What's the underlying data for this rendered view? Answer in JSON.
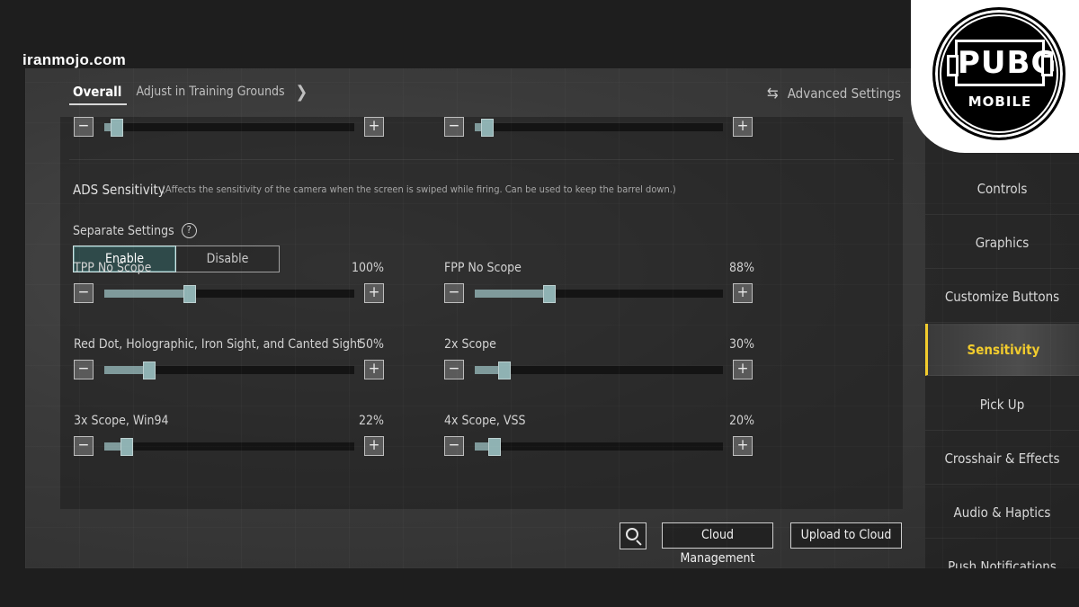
{
  "watermark": "iranmojo.com",
  "logo": {
    "title": "PUBG",
    "subtitle": "MOBILE"
  },
  "topnav": {
    "tab_overall": "Overall",
    "tab_adjust": "Adjust in Training Grounds",
    "advanced": "Advanced Settings"
  },
  "top_sliders": {
    "left_value": 0.05,
    "right_value": 0.05
  },
  "ads": {
    "title": "ADS Sensitivity",
    "description": "(Affects the sensitivity of the camera when the screen is swiped while firing. Can be used to keep the barrel down.)",
    "separate_label": "Separate Settings",
    "enable": "Enable",
    "disable": "Disable",
    "selected": "Enable",
    "sliders": [
      {
        "label": "TPP No Scope",
        "pct": "100%",
        "value": 0.34
      },
      {
        "label": "FPP No Scope",
        "pct": "88%",
        "value": 0.3
      },
      {
        "label": "Red Dot, Holographic, Iron Sight, and Canted Sight",
        "pct": "50%",
        "value": 0.18
      },
      {
        "label": "2x Scope",
        "pct": "30%",
        "value": 0.12
      },
      {
        "label": "3x Scope, Win94",
        "pct": "22%",
        "value": 0.09
      },
      {
        "label": "4x Scope, VSS",
        "pct": "20%",
        "value": 0.08
      }
    ]
  },
  "actions": {
    "cloud_management": "Cloud Management",
    "upload": "Upload to Cloud"
  },
  "sidebar": {
    "items": [
      "Controls",
      "Graphics",
      "Customize Buttons",
      "Sensitivity",
      "Pick Up",
      "Crosshair & Effects",
      "Audio & Haptics",
      "Push Notifications"
    ],
    "active": "Sensitivity"
  },
  "colors": {
    "accent": "#f2cc2d",
    "slider_fill": "#7f9a9b",
    "knob": "#8fb2b3"
  },
  "icons": {
    "swap": "swap-arrows-icon",
    "help": "question-circle-icon",
    "search": "search-icon",
    "chevron": "chevron-right-icon"
  }
}
